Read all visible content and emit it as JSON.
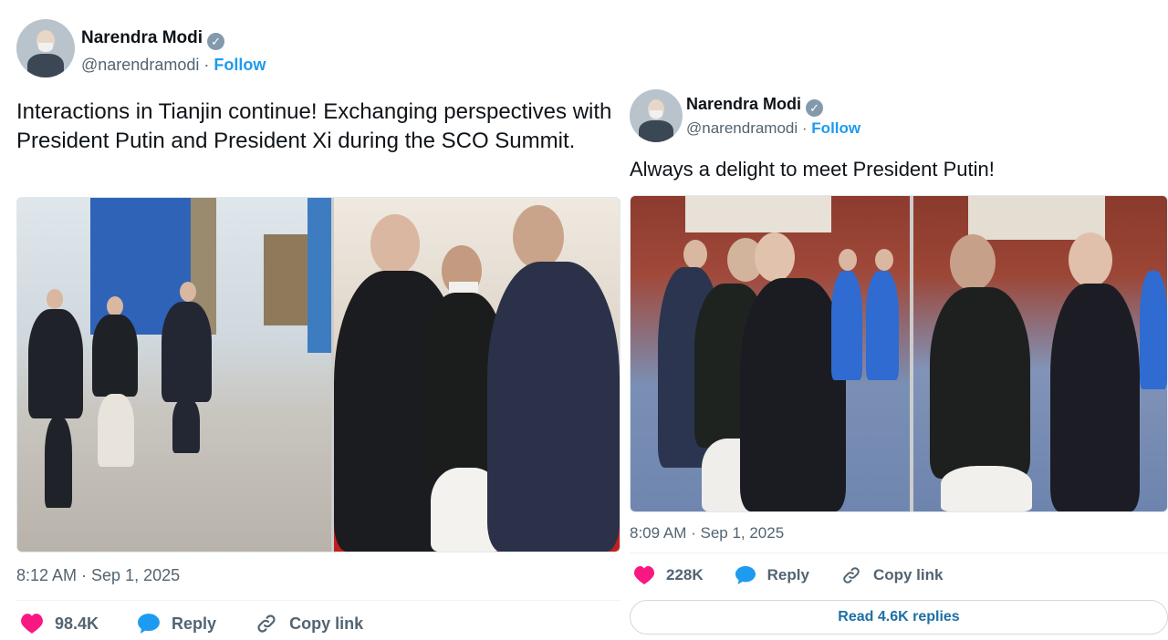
{
  "left_tweet": {
    "author": {
      "name": "Narendra Modi",
      "handle": "@narendramodi",
      "separator": "·",
      "follow_label": "Follow"
    },
    "text": "Interactions in Tianjin continue! Exchanging perspectives with President Putin and President Xi during the SCO Summit.",
    "timestamp": "8:12 AM · Sep 1, 2025",
    "actions": {
      "likes": "98.4K",
      "reply_label": "Reply",
      "copy_label": "Copy link"
    }
  },
  "right_tweet": {
    "author": {
      "name": "Narendra Modi",
      "handle": "@narendramodi",
      "separator": "·",
      "follow_label": "Follow"
    },
    "text": "Always a delight to meet President Putin!",
    "timestamp": "8:09 AM · Sep 1, 2025",
    "actions": {
      "likes": "228K",
      "reply_label": "Reply",
      "copy_label": "Copy link"
    },
    "read_replies_label": "Read 4.6K replies"
  },
  "colors": {
    "link": "#1d9bf0",
    "heart": "#f91880",
    "muted": "#536471",
    "verified": "#829aab"
  }
}
